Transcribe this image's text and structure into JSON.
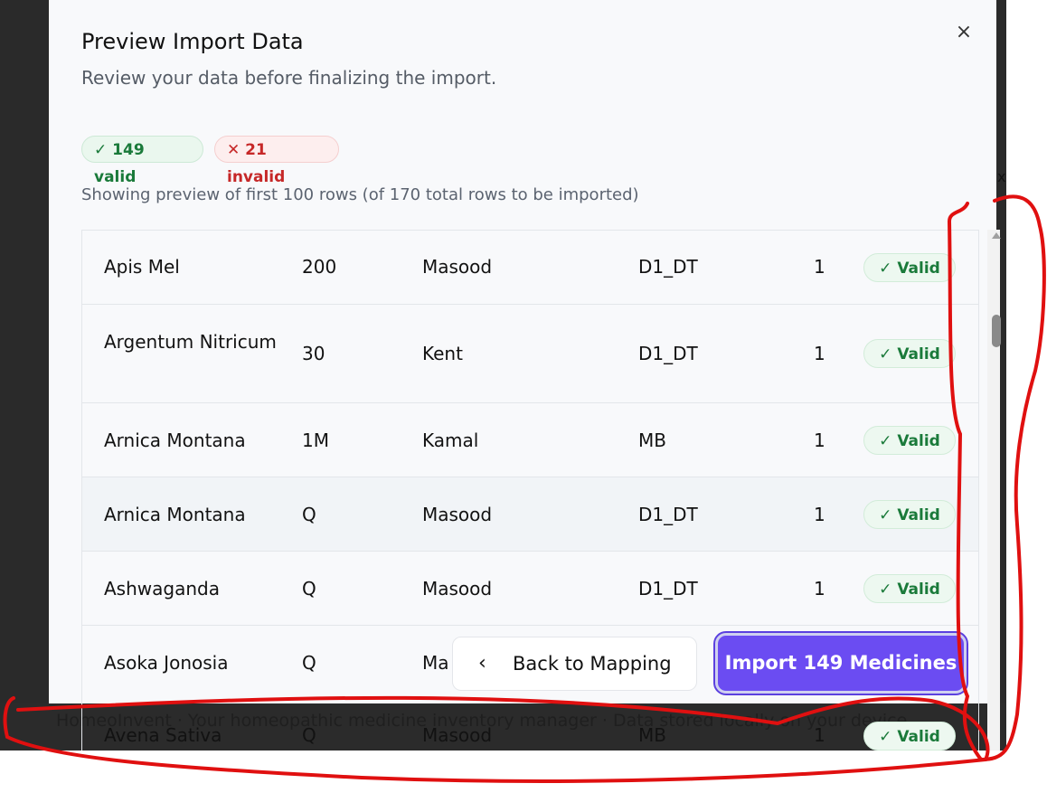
{
  "modal": {
    "title": "Preview Import Data",
    "subtitle": "Review your data before finalizing the import.",
    "close_icon": "×"
  },
  "summary": {
    "valid_label": "✓ 149 valid",
    "invalid_label": "✕ 21 invalid",
    "preview_note": "Showing preview of first 100 rows (of 170 total rows to be imported)"
  },
  "rows": [
    {
      "name": "Apis Mel",
      "potency": "200",
      "brand": "Masood",
      "location": "D1_DT",
      "qty": "1",
      "status": "✓ Valid"
    },
    {
      "name": "Argentum Nitricum",
      "potency": "30",
      "brand": "Kent",
      "location": "D1_DT",
      "qty": "1",
      "status": "✓ Valid"
    },
    {
      "name": "Arnica Montana",
      "potency": "1M",
      "brand": "Kamal",
      "location": "MB",
      "qty": "1",
      "status": "✓ Valid"
    },
    {
      "name": "Arnica Montana",
      "potency": "Q",
      "brand": "Masood",
      "location": "D1_DT",
      "qty": "1",
      "status": "✓ Valid"
    },
    {
      "name": "Ashwaganda",
      "potency": "Q",
      "brand": "Masood",
      "location": "D1_DT",
      "qty": "1",
      "status": "✓ Valid"
    },
    {
      "name": "Asoka Jonosia",
      "potency": "Q",
      "brand": "Ma",
      "location": "",
      "qty": "",
      "status": ""
    },
    {
      "name": "Avena Sativa",
      "potency": "Q",
      "brand": "Masood",
      "location": "MB",
      "qty": "1",
      "status": "✓ Valid"
    }
  ],
  "buttons": {
    "back_icon": "‹",
    "back_label": "Back to Mapping",
    "import_label": "Import 149 Medicines"
  },
  "footer": {
    "text": "HomeoInvent · Your homeopathic medicine inventory manager · Data stored locally on your device"
  },
  "background": {
    "right_x": "x"
  },
  "colors": {
    "primary": "#6b4cf2",
    "valid": "#1a7a3a",
    "invalid": "#c62828",
    "annotation": "#e01010"
  }
}
